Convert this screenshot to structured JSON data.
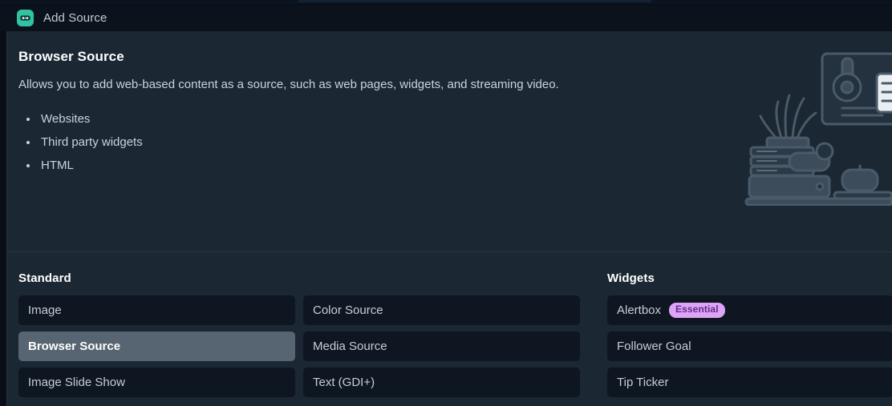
{
  "background_sliver": {
    "faint_text": "",
    "accent_color": "#16253a"
  },
  "titlebar": {
    "icon": "streamlabs-logo-icon",
    "title": "Add Source"
  },
  "hero": {
    "title": "Browser Source",
    "description": "Allows you to add web-based content as a source, such as web pages, widgets, and streaming video.",
    "features": [
      "Websites",
      "Third party widgets",
      "HTML"
    ],
    "illustration": "desk-setup-illustration"
  },
  "sections": [
    {
      "id": "standard",
      "title": "Standard",
      "items": [
        {
          "label": "Image",
          "selected": false
        },
        {
          "label": "Color Source",
          "selected": false
        },
        {
          "label": "Browser Source",
          "selected": true
        },
        {
          "label": "Media Source",
          "selected": false
        },
        {
          "label": "Image Slide Show",
          "selected": false
        },
        {
          "label": "Text (GDI+)",
          "selected": false
        }
      ]
    },
    {
      "id": "widgets",
      "title": "Widgets",
      "items": [
        {
          "label": "Alertbox",
          "selected": false,
          "badge": "Essential"
        },
        {
          "label": "Follower Goal",
          "selected": false
        },
        {
          "label": "Tip Ticker",
          "selected": false
        }
      ]
    }
  ],
  "colors": {
    "panel_background": "#1b2733",
    "item_background": "#0d1621",
    "item_selected_background": "#566571",
    "badge_background": "#dda4f5",
    "badge_text": "#5f2a91",
    "app_icon_background": "#31c3a2",
    "divider": "#2b3846"
  }
}
